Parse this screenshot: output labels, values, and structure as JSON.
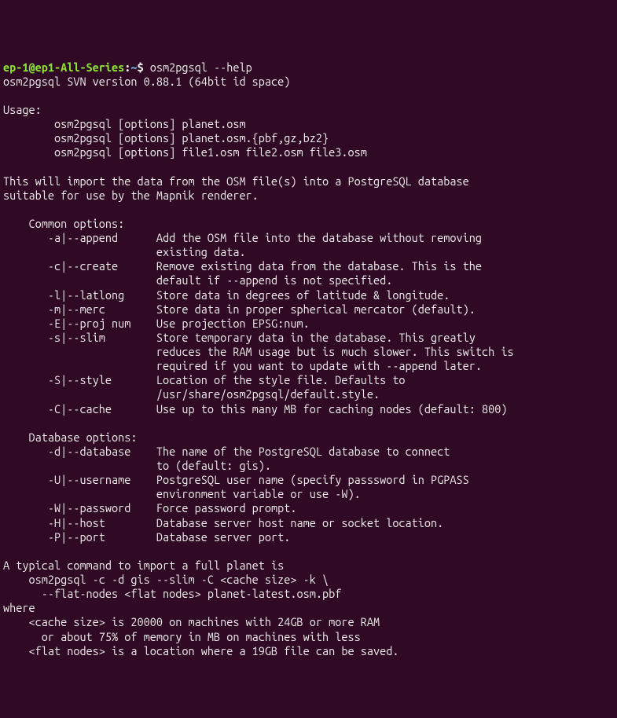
{
  "prompt": {
    "user_host": "ep-1@ep1-All-Series",
    "sep1": ":",
    "path": "~",
    "sep2": "$ ",
    "command": "osm2pgsql --help"
  },
  "output": {
    "version": "osm2pgsql SVN version 0.88.1 (64bit id space)",
    "blank1": "",
    "usage_header": "Usage:",
    "usage1": "        osm2pgsql [options] planet.osm",
    "usage2": "        osm2pgsql [options] planet.osm.{pbf,gz,bz2}",
    "usage3": "        osm2pgsql [options] file1.osm file2.osm file3.osm",
    "blank2": "",
    "desc1": "This will import the data from the OSM file(s) into a PostgreSQL database",
    "desc2": "suitable for use by the Mapnik renderer.",
    "blank3": "",
    "common_header": "    Common options:",
    "opt_append1": "       -a|--append      Add the OSM file into the database without removing",
    "opt_append2": "                        existing data.",
    "opt_create1": "       -c|--create      Remove existing data from the database. This is the",
    "opt_create2": "                        default if --append is not specified.",
    "opt_latlong": "       -l|--latlong     Store data in degrees of latitude & longitude.",
    "opt_merc": "       -m|--merc        Store data in proper spherical mercator (default).",
    "opt_proj": "       -E|--proj num    Use projection EPSG:num.",
    "opt_slim1": "       -s|--slim        Store temporary data in the database. This greatly",
    "opt_slim2": "                        reduces the RAM usage but is much slower. This switch is",
    "opt_slim3": "                        required if you want to update with --append later.",
    "opt_style1": "       -S|--style       Location of the style file. Defaults to",
    "opt_style2": "                        /usr/share/osm2pgsql/default.style.",
    "opt_cache": "       -C|--cache       Use up to this many MB for caching nodes (default: 800)",
    "blank4": "",
    "db_header": "    Database options:",
    "opt_db1": "       -d|--database    The name of the PostgreSQL database to connect",
    "opt_db2": "                        to (default: gis).",
    "opt_user1": "       -U|--username    PostgreSQL user name (specify passsword in PGPASS",
    "opt_user2": "                        environment variable or use -W).",
    "opt_pass": "       -W|--password    Force password prompt.",
    "opt_host": "       -H|--host        Database server host name or socket location.",
    "opt_port": "       -P|--port        Database server port.",
    "blank5": "",
    "typical1": "A typical command to import a full planet is",
    "typical2": "    osm2pgsql -c -d gis --slim -C <cache size> -k \\",
    "typical3": "      --flat-nodes <flat nodes> planet-latest.osm.pbf",
    "where": "where",
    "where1": "    <cache size> is 20000 on machines with 24GB or more RAM",
    "where2": "      or about 75% of memory in MB on machines with less",
    "where3": "    <flat nodes> is a location where a 19GB file can be saved."
  }
}
